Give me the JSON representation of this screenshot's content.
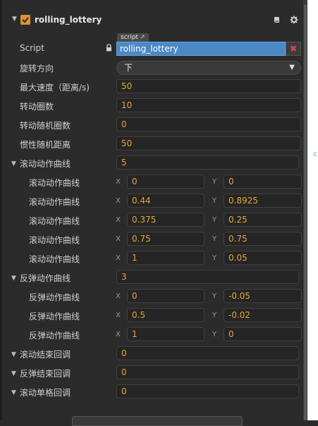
{
  "header": {
    "title": "rolling_lottery",
    "enabled": true
  },
  "script": {
    "label": "Script",
    "tag": "script",
    "value": "rolling_lottery",
    "clear_symbol": "✖"
  },
  "props": {
    "rotate_dir": {
      "label": "旋转方向",
      "value": "下"
    },
    "max_speed": {
      "label": "最大速度（距离/s)",
      "value": "50"
    },
    "turns": {
      "label": "转动圈数",
      "value": "10"
    },
    "rand_turns": {
      "label": "转动随机圈数",
      "value": "0"
    },
    "inertia_dist": {
      "label": "惯性随机距离",
      "value": "50"
    }
  },
  "scroll_curve": {
    "label": "滚动动作曲线",
    "count": "5",
    "items": [
      {
        "label": "滚动动作曲线",
        "x": "0",
        "y": "0"
      },
      {
        "label": "滚动动作曲线",
        "x": "0.44",
        "y": "0.8925"
      },
      {
        "label": "滚动动作曲线",
        "x": "0.375",
        "y": "0.25"
      },
      {
        "label": "滚动动作曲线",
        "x": "0.75",
        "y": "0.75"
      },
      {
        "label": "滚动动作曲线",
        "x": "1",
        "y": "0.05"
      }
    ]
  },
  "bounce_curve": {
    "label": "反弹动作曲线",
    "count": "3",
    "items": [
      {
        "label": "反弹动作曲线",
        "x": "0",
        "y": "-0.05"
      },
      {
        "label": "反弹动作曲线",
        "x": "0.5",
        "y": "-0.02"
      },
      {
        "label": "反弹动作曲线",
        "x": "1",
        "y": "0"
      }
    ]
  },
  "callbacks": {
    "scroll_end": {
      "label": "滚动结束回调",
      "value": "0"
    },
    "bounce_end": {
      "label": "反弹结束回调",
      "value": "0"
    },
    "scroll_step": {
      "label": "滚动单格回调",
      "value": "0"
    }
  },
  "axis_labels": {
    "x": "X",
    "y": "Y"
  },
  "colors": {
    "accent_orange": "#e0912d",
    "value_text": "#e3a73a",
    "selected_blue": "#4a88c6",
    "panel_bg": "#2b2b2b"
  }
}
